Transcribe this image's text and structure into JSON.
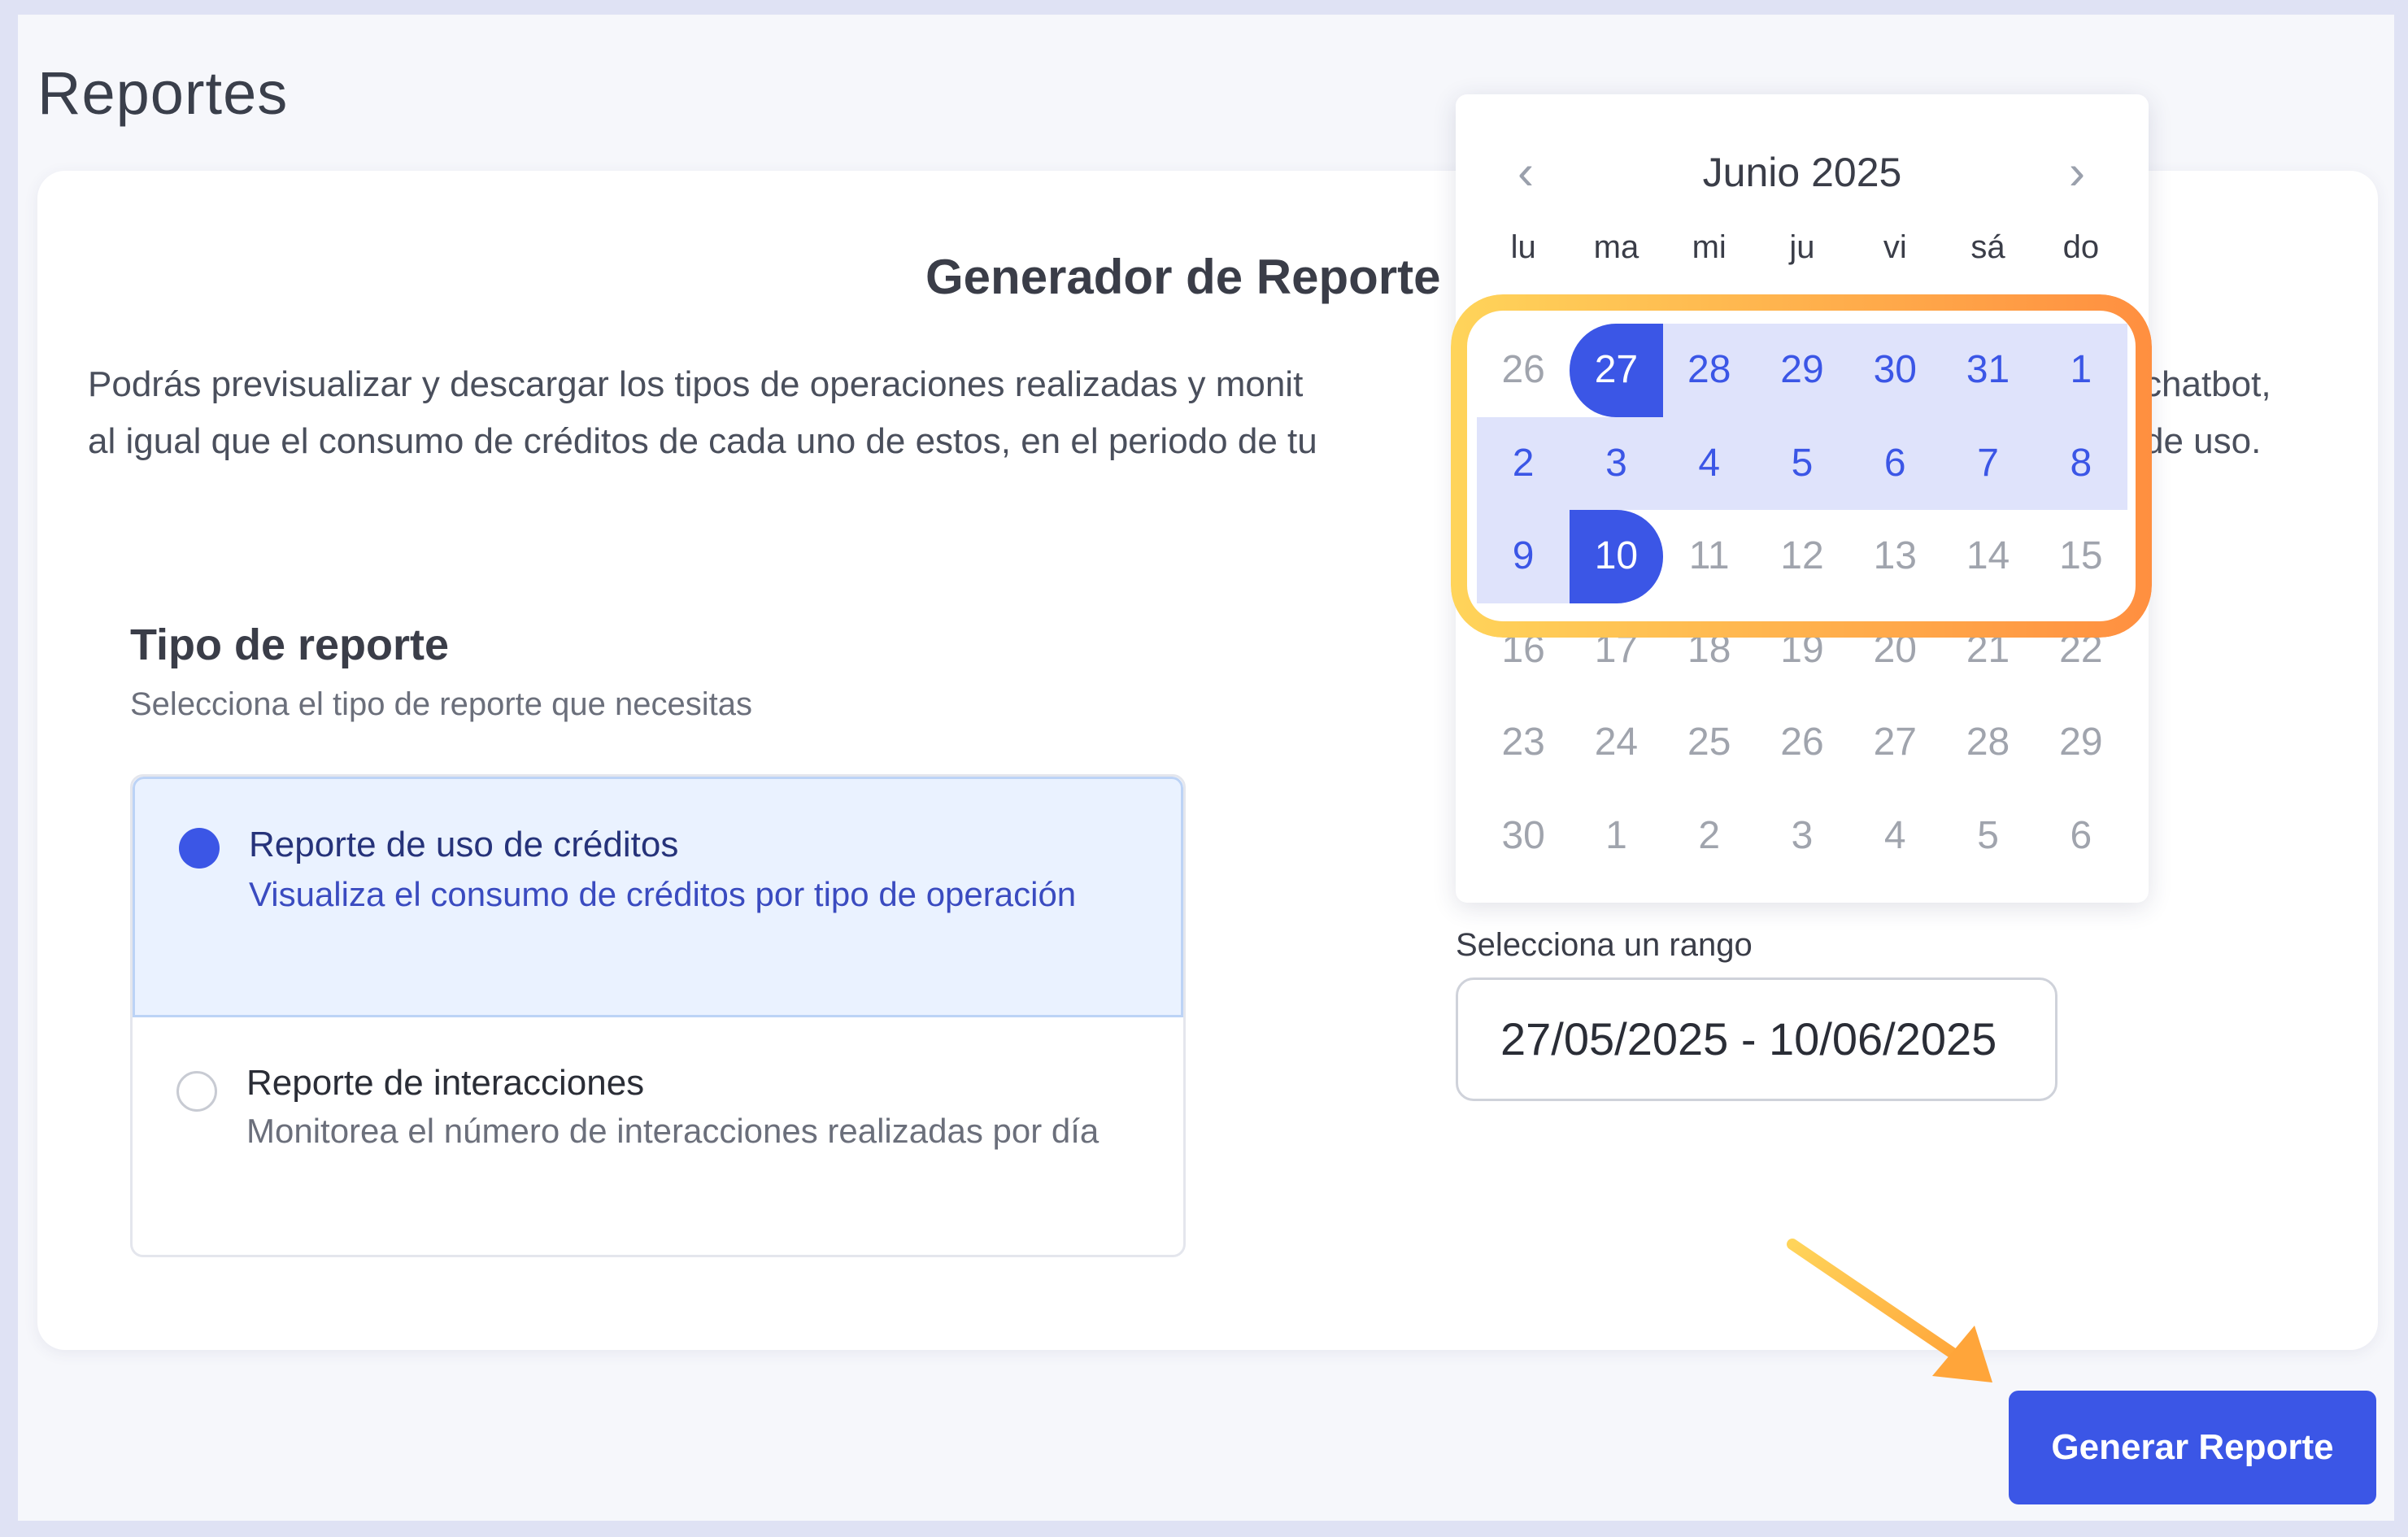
{
  "page": {
    "title": "Reportes"
  },
  "generator": {
    "title": "Generador de Reporte",
    "desc_line1": "Podrás previsualizar y descargar los tipos de operaciones realizadas y monit",
    "desc_line2": "al igual que el consumo de créditos de cada uno de estos, en el periodo de tu",
    "desc_tail1": "chatbot,",
    "desc_tail2": "de uso."
  },
  "report_type": {
    "title": "Tipo de reporte",
    "subtitle": "Selecciona el tipo de reporte que necesitas",
    "options": [
      {
        "title": "Reporte de uso de créditos",
        "desc": "Visualiza el consumo de créditos por tipo de operación",
        "selected": true
      },
      {
        "title": "Reporte de interacciones",
        "desc": "Monitorea el número de interacciones realizadas por día",
        "selected": false
      }
    ]
  },
  "range": {
    "label": "Selecciona un rango",
    "value": "27/05/2025 - 10/06/2025"
  },
  "calendar": {
    "month": "Junio 2025",
    "prev_icon": "chevron-left-icon",
    "next_icon": "chevron-right-icon",
    "weekdays": [
      "lu",
      "ma",
      "mi",
      "ju",
      "vi",
      "sá",
      "do"
    ],
    "rows": [
      [
        "26",
        "27",
        "28",
        "29",
        "30",
        "31",
        "1"
      ],
      [
        "2",
        "3",
        "4",
        "5",
        "6",
        "7",
        "8"
      ],
      [
        "9",
        "10",
        "11",
        "12",
        "13",
        "14",
        "15"
      ],
      [
        "16",
        "17",
        "18",
        "19",
        "20",
        "21",
        "22"
      ],
      [
        "23",
        "24",
        "25",
        "26",
        "27",
        "28",
        "29"
      ],
      [
        "30",
        "1",
        "2",
        "3",
        "4",
        "5",
        "6"
      ]
    ],
    "range_start": "27/05/2025",
    "range_end": "10/06/2025"
  },
  "actions": {
    "generate": "Generar Reporte"
  },
  "colors": {
    "accent": "#3b56e6",
    "range_bg": "#dfe3fb",
    "highlight_start": "#ffd45a",
    "highlight_end": "#ff8f40"
  }
}
